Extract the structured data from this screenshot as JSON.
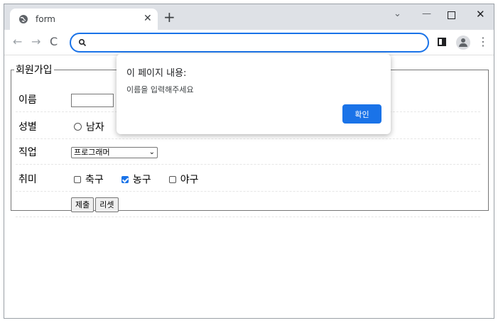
{
  "browser": {
    "tab": {
      "title": "form",
      "globe_icon": "globe-icon",
      "close_glyph": "✕"
    },
    "new_tab_glyph": "+",
    "window_controls": {
      "dropdown": "⌄",
      "minimize": "—",
      "close": "✕"
    },
    "nav": {
      "back": "←",
      "forward": "→",
      "reload": "C"
    },
    "address_bar": {
      "value": "",
      "icon": "search-icon"
    },
    "menu_glyph": "⋮",
    "accent_color": "#1a73e8"
  },
  "form": {
    "legend": "회원가입",
    "name": {
      "label": "이름",
      "value": ""
    },
    "gender": {
      "label": "성별",
      "options": [
        "남자"
      ],
      "selected": null
    },
    "job": {
      "label": "직업",
      "selected": "프로그래머",
      "arrow": "⌄"
    },
    "hobby": {
      "label": "취미",
      "options": [
        {
          "label": "축구",
          "checked": false
        },
        {
          "label": "농구",
          "checked": true
        },
        {
          "label": "야구",
          "checked": false
        }
      ]
    },
    "buttons": {
      "submit": "제출",
      "reset": "리셋"
    }
  },
  "alert": {
    "title": "이 페이지 내용:",
    "message": "이름을 입력해주세요",
    "ok_label": "확인"
  }
}
